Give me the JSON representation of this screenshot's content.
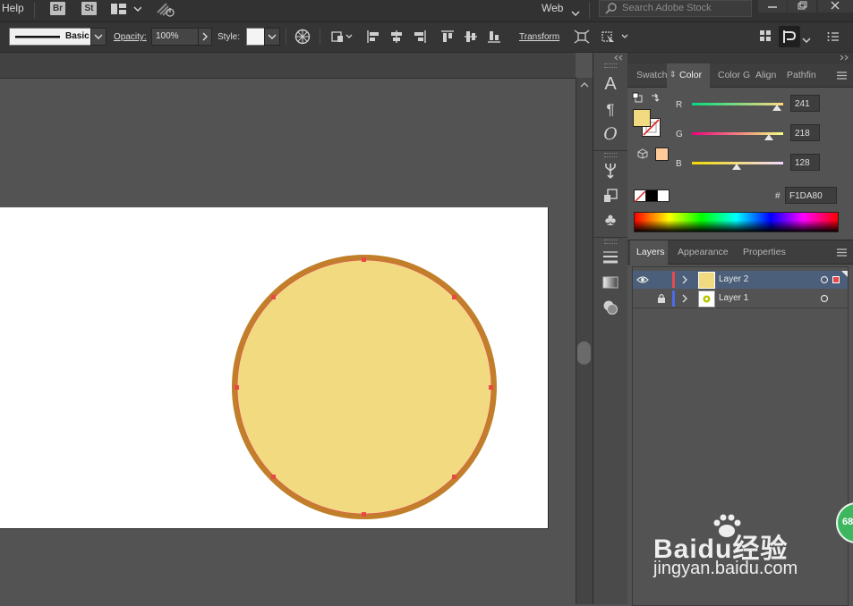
{
  "menu": {
    "help_label": "Help",
    "bridge_badge": "Br",
    "stock_badge": "St",
    "workspace_label": "Web",
    "search_placeholder": "Search Adobe Stock"
  },
  "control_bar": {
    "stroke_profile": "Basic",
    "opacity_label": "Opacity:",
    "opacity_value": "100%",
    "style_label": "Style:",
    "transform_label": "Transform"
  },
  "color_panel": {
    "tabs": [
      {
        "label": "Swatch",
        "active": false
      },
      {
        "label": "Color",
        "active": true
      },
      {
        "label": "Color G",
        "active": false
      },
      {
        "label": "Align",
        "active": false
      },
      {
        "label": "Pathfin",
        "active": false
      }
    ],
    "r_label": "R",
    "r_value": "241",
    "g_label": "G",
    "g_value": "218",
    "b_label": "B",
    "b_value": "128",
    "hex_label": "#",
    "hex_value": "F1DA80",
    "fill_color": "#F1DA80",
    "stroke_color": "#C17F2A"
  },
  "layers_panel": {
    "tabs": [
      {
        "label": "Layers",
        "active": true
      },
      {
        "label": "Appearance",
        "active": false
      },
      {
        "label": "Properties",
        "active": false
      }
    ],
    "layers": [
      {
        "name": "Layer 2",
        "visible": true,
        "locked": false,
        "color": "#E84B4B",
        "selected": true
      },
      {
        "name": "Layer 1",
        "visible": false,
        "locked": true,
        "color": "#4B6BE8",
        "selected": false
      }
    ]
  },
  "artwork": {
    "shape": "circle",
    "fill": "#F1DA80",
    "stroke": "#C17F2A"
  },
  "overlay": {
    "badge_text": "68",
    "watermark_brand": "Baidu经验",
    "watermark_url": "jingyan.baidu.com"
  }
}
